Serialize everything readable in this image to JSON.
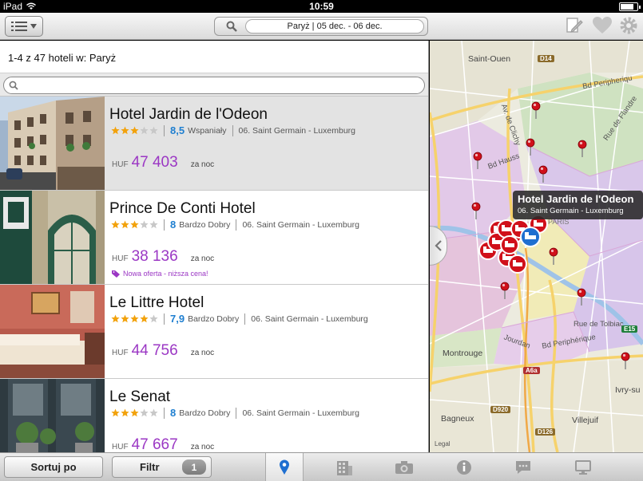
{
  "status": {
    "device": "iPad",
    "time": "10:59",
    "battery_level": 0.8
  },
  "toolbar": {
    "search_summary": "Paryż | 05 dec. - 06 dec."
  },
  "list": {
    "header": "1-4 z 47 hoteli w: Paryż",
    "search_placeholder": "",
    "hotels": [
      {
        "name": "Hotel Jardin de l'Odeon",
        "stars": 3,
        "score": "8,5",
        "rating_label": "Wspaniały",
        "district": "06. Saint Germain - Luxemburg",
        "currency": "HUF",
        "price": "47 403",
        "per_night": "za noc",
        "offer": "",
        "selected": true
      },
      {
        "name": "Prince De Conti Hotel",
        "stars": 3,
        "score": "8",
        "rating_label": "Bardzo Dobry",
        "district": "06. Saint Germain - Luxemburg",
        "currency": "HUF",
        "price": "38 136",
        "per_night": "za noc",
        "offer": "Nowa oferta - niższa cena!",
        "selected": false
      },
      {
        "name": "Le Littre Hotel",
        "stars": 4,
        "score": "7,9",
        "rating_label": "Bardzo Dobry",
        "district": "06. Saint Germain - Luxemburg",
        "currency": "HUF",
        "price": "44 756",
        "per_night": "za noc",
        "offer": "",
        "selected": false
      },
      {
        "name": "Le Senat",
        "stars": 3,
        "score": "8",
        "rating_label": "Bardzo Dobry",
        "district": "06. Saint Germain - Luxemburg",
        "currency": "HUF",
        "price": "47 667",
        "per_night": "za noc",
        "offer": "",
        "selected": false
      }
    ]
  },
  "map": {
    "callout_title": "Hotel Jardin de l'Odeon",
    "callout_subtitle": "06. Saint Germain - Luxemburg",
    "places": {
      "saint_ouen": "Saint-Ouen",
      "paris": "PARIS",
      "montrouge": "Montrouge",
      "bagneux": "Bagneux",
      "villejuif": "Villejuif",
      "ivry": "Ivry-su"
    },
    "roads": {
      "bd_peripherique_top": "Bd Peripheriqu",
      "bd_haussmann": "Bd Hauss",
      "bd_peripherique_bottom": "Bd Periphérique",
      "rue_de_tolbiac": "Rue de Tolbiac",
      "rue_de_flandre": "Rue de Flandre",
      "av_de_clichy": "Av. de Clichy",
      "jourdan": "Jourdan"
    },
    "signs": {
      "d14": "D14",
      "e15": "E15",
      "a6a": "A6a",
      "d920": "D920",
      "d126": "D126"
    },
    "legal": "Legal"
  },
  "bottombar": {
    "sort_label": "Sortuj po",
    "filter_label": "Filtr",
    "filter_count": "1"
  },
  "icons": [
    "list-menu-icon",
    "search-icon",
    "edit-icon",
    "heart-icon",
    "gear-icon",
    "map-pin-icon",
    "building-icon",
    "camera-icon",
    "info-icon",
    "comment-icon",
    "monitor-icon",
    "tag-icon",
    "chevron-left-icon"
  ],
  "colors": {
    "accent_price": "#9b37c4",
    "score_blue": "#1f7fd0",
    "star_gold": "#f2a20c",
    "pin_red": "#d0101a"
  }
}
